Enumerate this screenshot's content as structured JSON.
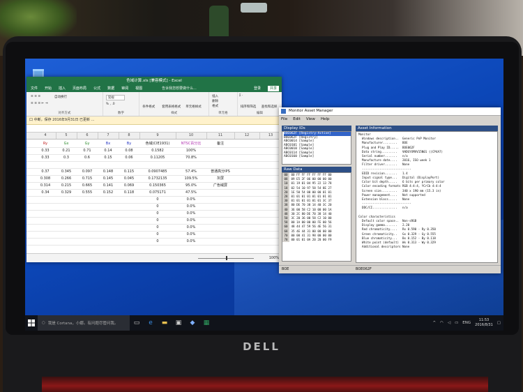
{
  "excel": {
    "title": "色域计算.xls [兼容模式] - Excel",
    "menu": [
      "文件",
      "开始",
      "插入",
      "页面布局",
      "公式",
      "数据",
      "审阅",
      "视图"
    ],
    "tell_me": "告诉我您想要做什么...",
    "user": "登录",
    "share": "共享",
    "ribbon": {
      "wrap_text": "自动换行",
      "number_format": "常规",
      "conditional_format": "条件格式",
      "table_format": "套用表格格式",
      "cell_styles": "单元格样式",
      "insert": "插入",
      "delete": "删除",
      "format": "格式",
      "sort_filter": "排序和筛选",
      "find_select": "查找和选择",
      "group_align": "对齐方式",
      "group_number": "数字",
      "group_styles": "样式",
      "group_cells": "单元格",
      "group_edit": "编辑"
    },
    "message": "口 中断，保存 2016年9月31日 已更新 ...",
    "columns": [
      "4",
      "5",
      "6",
      "7",
      "8",
      "9",
      "10",
      "11",
      "12",
      "13"
    ],
    "rows": [
      [
        "Ry",
        "Gx",
        "Gy",
        "Bx",
        "By",
        "色域(CIE1931)",
        "NTSC百分比",
        "备注",
        "",
        ""
      ],
      [
        "0.33",
        "0.21",
        "0.71",
        "0.14",
        "0.08",
        "0.1582",
        "100%",
        "",
        "",
        ""
      ],
      [
        "0.33",
        "0.3",
        "0.6",
        "0.15",
        "0.06",
        "0.11205",
        "70.8%",
        "",
        "",
        ""
      ],
      [
        "",
        "",
        "",
        "",
        "",
        "",
        "",
        "",
        "",
        ""
      ],
      [
        "0.37",
        "0.345",
        "0.097",
        "0.148",
        "0.115",
        "0.0907485",
        "57.4%",
        "普通高分IPS",
        "",
        ""
      ],
      [
        "0.308",
        "0.266",
        "0.715",
        "0.145",
        "0.045",
        "0.1732135",
        "109.5%",
        "灰屏",
        "",
        ""
      ],
      [
        "0.314",
        "0.215",
        "0.665",
        "0.141",
        "0.069",
        "0.150365",
        "95.0%",
        "广色域屏",
        "",
        ""
      ],
      [
        "0.34",
        "0.329",
        "0.555",
        "0.152",
        "0.118",
        "0.075171",
        "47.5%",
        "",
        "",
        ""
      ],
      [
        "",
        "",
        "",
        "",
        "",
        "0",
        "0.0%",
        "",
        "",
        ""
      ],
      [
        "",
        "",
        "",
        "",
        "",
        "0",
        "0.0%",
        "",
        "",
        ""
      ],
      [
        "",
        "",
        "",
        "",
        "",
        "0",
        "0.0%",
        "",
        "",
        ""
      ],
      [
        "",
        "",
        "",
        "",
        "",
        "0",
        "0.0%",
        "",
        "",
        ""
      ],
      [
        "",
        "",
        "",
        "",
        "",
        "0",
        "0.0%",
        "",
        "",
        ""
      ],
      [
        "",
        "",
        "",
        "",
        "",
        "0",
        "0.0%",
        "",
        "",
        ""
      ],
      [
        "",
        "",
        "",
        "",
        "",
        "0",
        "0.0%",
        "",
        "",
        ""
      ]
    ],
    "zoom": "100%"
  },
  "mam": {
    "title": "Monitor Asset Manager",
    "menu": [
      "File",
      "Edit",
      "View",
      "Help"
    ],
    "display_ids_header": "Display IDs",
    "raw_data_header": "Raw Data",
    "asset_info_header": "Asset Information",
    "display_ids": [
      "BOE062F   [Registry-Active]",
      "BOE062F   [Registry]",
      "ABC0014   [Sample]",
      "ABC0101   [Sample]",
      "ABC0010   [Sample]",
      "ABC0114   [Sample]",
      "ABC0160   [Sample]"
    ],
    "raw_rows": [
      [
        "00",
        "00 FF FF FF FF FF FF 00"
      ],
      [
        "08",
        "09 E5 2F 06 00 00 00 00"
      ],
      [
        "10",
        "01 19 01 04 95 22 13 78"
      ],
      [
        "18",
        "02 54 10 97 58 54 8E 27"
      ],
      [
        "20",
        "1E 50 54 00 00 00 01 01"
      ],
      [
        "28",
        "01 01 01 01 01 01 01 01"
      ],
      [
        "30",
        "01 01 01 01 01 01 3C 37"
      ],
      [
        "38",
        "80 DE 70 38 14 40 3C 20"
      ],
      [
        "40",
        "36 00 58 C2 10 00 00 1A"
      ],
      [
        "48",
        "30 2C 80 DE 70 38 14 40"
      ],
      [
        "50",
        "3C 20 36 00 58 C2 10 00"
      ],
      [
        "58",
        "00 1A 00 00 00 FE 00 56"
      ],
      [
        "60",
        "48 44 47 59 56 4E 56 31"
      ],
      [
        "68",
        "35 4E 44 31 00 00 00 00"
      ],
      [
        "70",
        "00 00 41 31 98 00 00 00"
      ],
      [
        "78",
        "00 01 01 0A 20 20 00 F9"
      ]
    ],
    "info_lines": [
      "Monitor",
      "  Windows description..  Generic PnP Monitor",
      "  Manufacturer........   BOE",
      "  Plug and Play ID.....  BOE062F",
      "  Data string.........   VHDGYXMVV15N01 ((CP4A7)",
      "  Serial number.......   n/a",
      "  Manufacture date....   2016, ISO week 1",
      "  Filter driver.......   None",
      "  ----------------------------",
      "  EDID revision.......   1.4",
      "  Input signal type...   Digital (DisplayPort)",
      "  Color bit depth.....   6 bits per primary color",
      "  Color encoding formats RGB 4:4:4, YCrCb 4:4:4",
      "  Screen size.........   340 x 190 mm (15.3 in)",
      "  Power management....   Not supported",
      "  Extension blocs.....   None",
      "  ----------------------------",
      "  DDC/CI..............   n/a",
      "",
      "Color characteristics",
      "  Default color space..  Non-sRGB",
      "  Display gamma.......   2.20",
      "  Red chromaticity....   Rx 0.590 - Ry 0.350",
      "  Green chromaticity..   Gx 0.329 - Gy 0.555",
      "  Blue chromaticity...   Bx 0.152 - By 0.118",
      "  White point (default)  Wx 0.313 - Wy 0.329",
      "  Additional descriptors None"
    ],
    "status_left": "BOE",
    "status_mid": "BOE062F"
  },
  "taskbar": {
    "search_placeholder": "我是 Cortana，小娜。有问题尽管问我。",
    "lang": "ENG",
    "time": "11:53",
    "date": "2016/8/31"
  },
  "brand": "DELL"
}
